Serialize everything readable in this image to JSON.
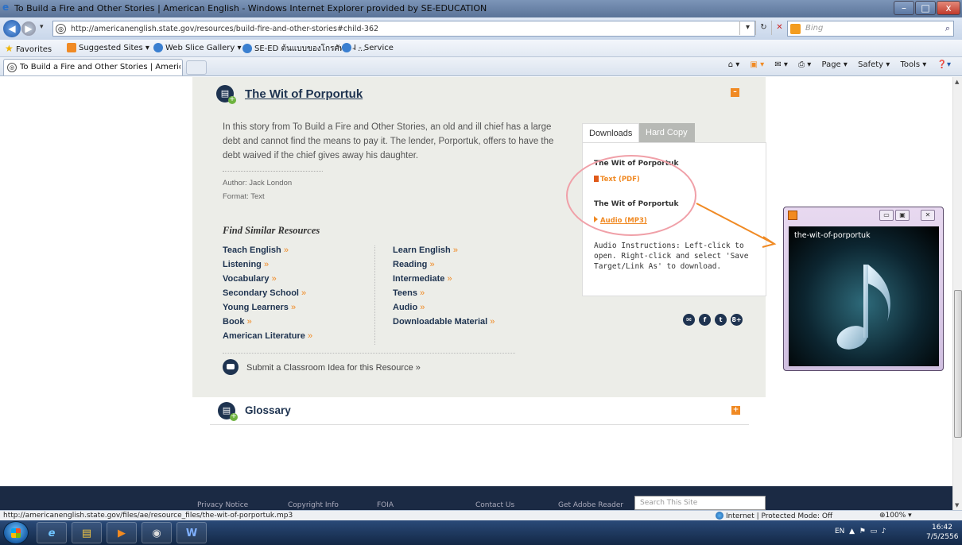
{
  "window": {
    "title": "To Build a Fire and Other Stories | American English - Windows Internet Explorer provided by SE-EDUCATION",
    "min_label": "–",
    "max_label": "□",
    "close_label": "x"
  },
  "address_bar": {
    "url": "http://americanenglish.state.gov/resources/build-fire-and-other-stories#child-362",
    "search_placeholder": "Bing"
  },
  "favorites_bar": {
    "favorites_label": "Favorites",
    "items": [
      {
        "label": "Suggested Sites ▾"
      },
      {
        "label": "Web Slice Gallery ▾"
      },
      {
        "label": "SE-ED ต้นแบบของโกรศัพท์ - ..."
      },
      {
        "label": "I - Service"
      }
    ]
  },
  "tab": {
    "label": "To Build a Fire and Other Stories | American Engli..."
  },
  "command_bar": {
    "page": "Page ▾",
    "safety": "Safety ▾",
    "tools": "Tools ▾"
  },
  "resource": {
    "title": "The Wit of Porportuk",
    "description": "In this story from To Build a Fire and Other Stories, an old and ill chief has a large debt and cannot find the means to pay it. The lender, Porportuk, offers to have the debt waived if the chief gives away his daughter.",
    "author": "Author: Jack London",
    "format": "Format: Text",
    "find_similar": "Find Similar Resources",
    "links_left": [
      "Teach English",
      "Listening",
      "Vocabulary",
      "Secondary School",
      "Young Learners",
      "Book",
      "American Literature"
    ],
    "links_right": [
      "Learn English",
      "Reading",
      "Intermediate",
      "Teens",
      "Audio",
      "Downloadable Material"
    ],
    "link_arrow": "»",
    "submit_idea": "Submit a Classroom Idea for this Resource »",
    "collapse_label": "–"
  },
  "downloads": {
    "tab_downloads": "Downloads",
    "tab_hardcopy": "Hard Copy",
    "items": [
      {
        "title": "The Wit of Porportuk",
        "link": "Text (PDF)"
      },
      {
        "title": "The Wit of Porportuk",
        "link": "Audio (MP3)"
      }
    ],
    "instructions": "Audio Instructions: Left-click to open. Right-click and select 'Save Target/Link As' to download."
  },
  "social": [
    "✉",
    "f",
    "t",
    "8+"
  ],
  "glossary": {
    "title": "Glossary",
    "expand_label": "+"
  },
  "footer": {
    "links": [
      "Privacy Notice",
      "Copyright Info",
      "FOIA",
      "Contact Us",
      "Get Adobe Reader"
    ],
    "search_placeholder": "Search This Site"
  },
  "media_player": {
    "track": "the-wit-of-porportuk"
  },
  "status_bar": {
    "url": "http://americanenglish.state.gov/files/ae/resource_files/the-wit-of-porportuk.mp3",
    "zone": "Internet | Protected Mode: Off",
    "zoom": "100%"
  },
  "taskbar": {
    "language": "EN",
    "time": "16:42",
    "date": "7/5/2556"
  },
  "colors": {
    "accent": "#f08a24",
    "navy": "#1e3350",
    "panel_bg": "#ecede8"
  }
}
